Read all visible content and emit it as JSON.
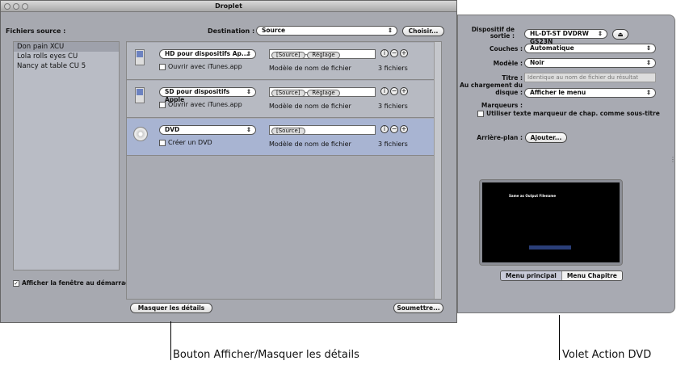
{
  "window": {
    "title": "Droplet"
  },
  "source": {
    "label": "Fichiers source :",
    "files": [
      "Don pain XCU",
      "Lola rolls eyes CU",
      "Nancy at table CU 5"
    ],
    "show_at_launch_label": "Afficher la fenêtre au démarrage",
    "show_at_launch": true
  },
  "destination": {
    "label": "Destination :",
    "value": "Source",
    "choose_label": "Choisir..."
  },
  "settings": [
    {
      "preset": "HD pour dispositifs Ap...",
      "tokens": [
        "[Source]",
        "Réglage"
      ],
      "option": "Ouvrir avec iTunes.app",
      "template_label": "Modèle de nom de fichier",
      "count": "3 fichiers",
      "icon": "ipod-icon",
      "selected": false
    },
    {
      "preset": "SD pour dispositifs Apple",
      "tokens": [
        "[Source]",
        "Réglage"
      ],
      "option": "Ouvrir avec iTunes.app",
      "template_label": "Modèle de nom de fichier",
      "count": "3 fichiers",
      "icon": "ipod-icon",
      "selected": false
    },
    {
      "preset": "DVD",
      "tokens": [
        "[Source]"
      ],
      "option": "Créer un DVD",
      "template_label": "Modèle de nom de fichier",
      "count": "3 fichiers",
      "icon": "dvd-disc-icon",
      "selected": true
    }
  ],
  "buttons": {
    "hide_details": "Masquer les détails",
    "submit": "Soumettre..."
  },
  "dvd_panel": {
    "output_device_label": "Dispositif de sortie :",
    "output_device": "HL-DT-ST DVDRW  GS23N",
    "layers_label": "Couches :",
    "layers": "Automatique",
    "template_label": "Modèle :",
    "template": "Noir",
    "title_label": "Titre :",
    "title_placeholder": "Identique au nom de fichier du résultat",
    "on_load_label": "Au chargement du disque :",
    "on_load": "Afficher le menu",
    "markers_label": "Marqueurs :",
    "markers_option": "Utiliser texte marqueur de chap. comme sous-titre",
    "background_label": "Arrière-plan :",
    "background_button": "Ajouter...",
    "preview_title": "Same as Output Filename",
    "tabs": [
      "Menu principal",
      "Menu Chapitre"
    ],
    "active_tab": 0
  },
  "callouts": {
    "left": "Bouton Afficher/Masquer les détails",
    "right": "Volet Action DVD"
  },
  "colors": {
    "selected_row": "#a8b4d2",
    "window": "#a7a9b0"
  }
}
